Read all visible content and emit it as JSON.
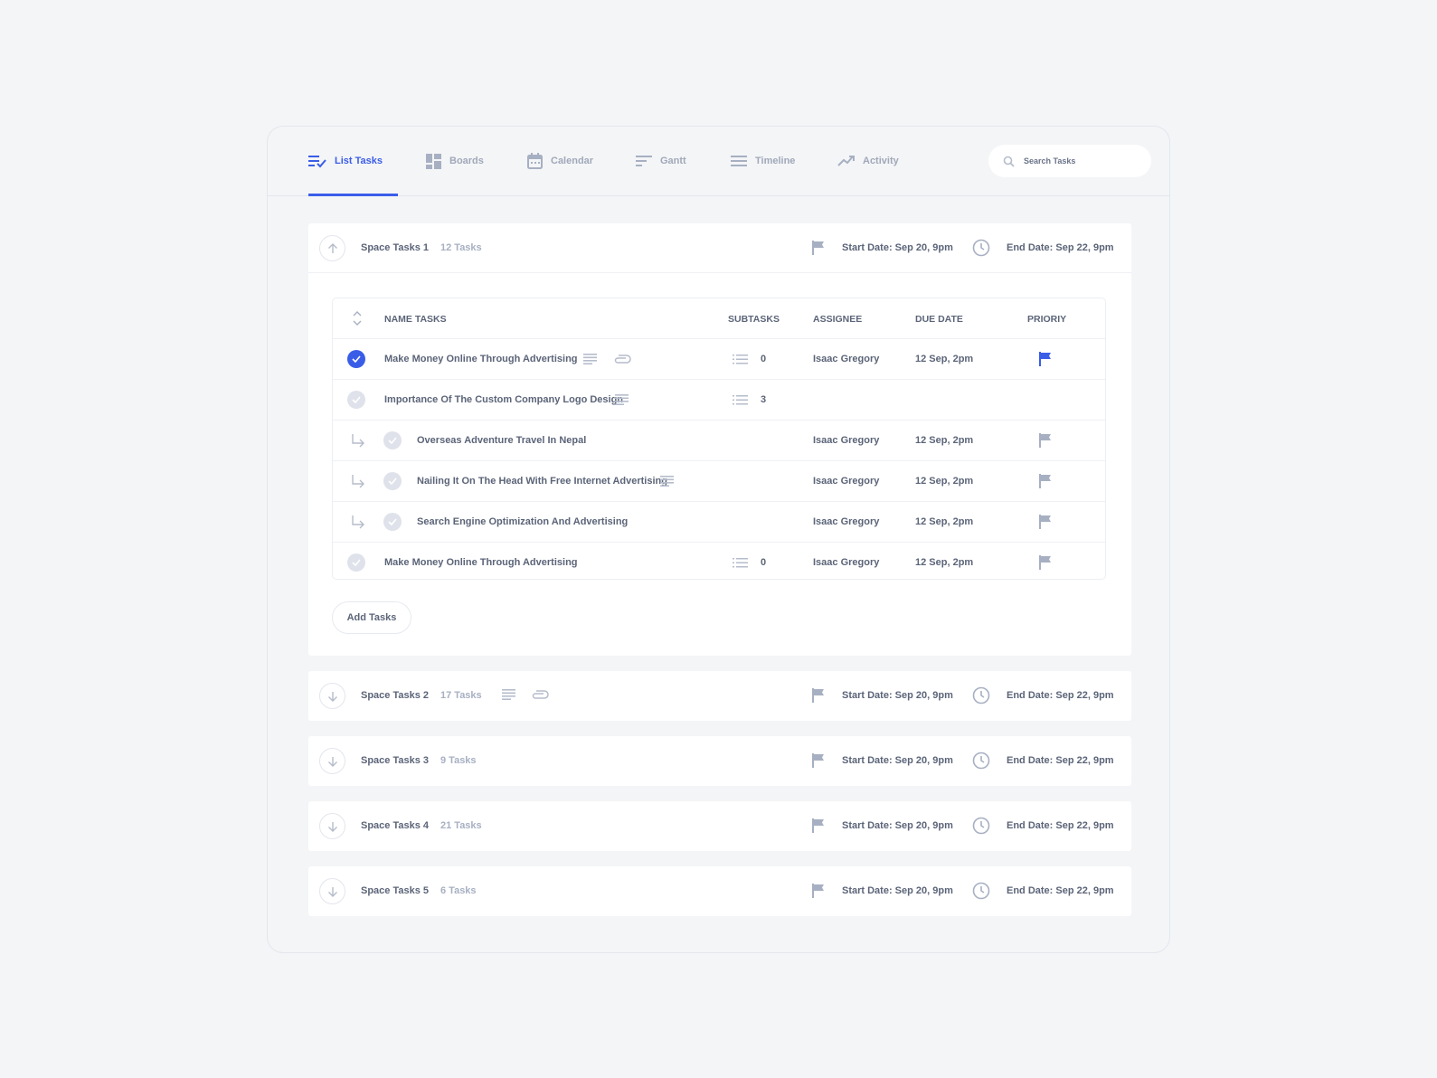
{
  "tabs": [
    {
      "label": "List Tasks",
      "icon": "list-check-icon",
      "active": true
    },
    {
      "label": "Boards",
      "icon": "boards-icon"
    },
    {
      "label": "Calendar",
      "icon": "calendar-icon"
    },
    {
      "label": "Gantt",
      "icon": "gantt-icon"
    },
    {
      "label": "Timeline",
      "icon": "timeline-icon"
    },
    {
      "label": "Activity",
      "icon": "activity-icon"
    }
  ],
  "search": {
    "placeholder": "Search Tasks"
  },
  "colors": {
    "accent": "#3a5de8",
    "muted": "#a7b0c2",
    "text": "#5b6478"
  },
  "groups": [
    {
      "name": "Space Tasks 1",
      "count": "12 Tasks",
      "start": "Start Date: Sep 20, 9pm",
      "end": "End Date: Sep 22, 9pm",
      "expanded": true
    },
    {
      "name": "Space Tasks 2",
      "count": "17 Tasks",
      "start": "Start Date: Sep 20, 9pm",
      "end": "End Date: Sep 22, 9pm"
    },
    {
      "name": "Space Tasks 3",
      "count": "9 Tasks",
      "start": "Start Date: Sep 20, 9pm",
      "end": "End Date: Sep 22, 9pm"
    },
    {
      "name": "Space Tasks 4",
      "count": "21 Tasks",
      "start": "Start Date: Sep 20, 9pm",
      "end": "End Date: Sep 22, 9pm"
    },
    {
      "name": "Space Tasks 5",
      "count": "6 Tasks",
      "start": "Start Date: Sep 20, 9pm",
      "end": "End Date: Sep 22, 9pm"
    }
  ],
  "table": {
    "headers": {
      "name": "NAME TASKS",
      "subtasks": "SUBTASKS",
      "assignee": "ASSIGNEE",
      "due": "DUE DATE",
      "priority": "PRIORIY"
    },
    "rows": [
      {
        "name": "Make Money Online Through Advertising",
        "subtasks": "0",
        "assignee": "Isaac Gregory",
        "due": "12 Sep, 2pm",
        "done": true,
        "priority": "high"
      },
      {
        "name": "Importance Of The Custom Company Logo Design",
        "subtasks": "3",
        "assignee": "",
        "due": ""
      },
      {
        "name": "Overseas Adventure Travel In Nepal",
        "assignee": "Isaac Gregory",
        "due": "12 Sep, 2pm",
        "subtask": true
      },
      {
        "name": "Nailing It On The Head With Free Internet Advertising",
        "assignee": "Isaac Gregory",
        "due": "12 Sep, 2pm",
        "subtask": true
      },
      {
        "name": "Search Engine Optimization And Advertising",
        "assignee": "Isaac Gregory",
        "due": "12 Sep, 2pm",
        "subtask": true
      },
      {
        "name": "Make Money Online Through Advertising",
        "subtasks": "0",
        "assignee": "Isaac Gregory",
        "due": "12 Sep, 2pm"
      }
    ]
  },
  "add_button": "Add Tasks"
}
